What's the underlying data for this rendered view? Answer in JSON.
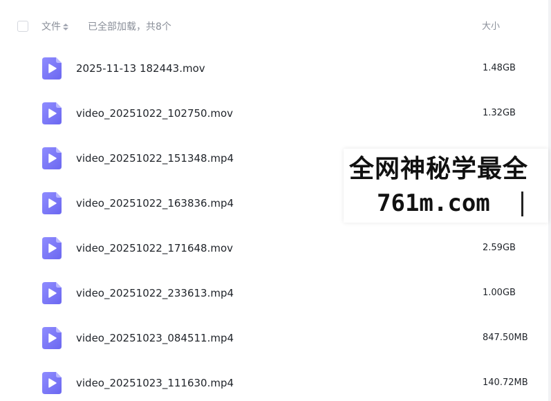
{
  "header": {
    "name_column_label": "文件",
    "load_status": "已全部加载，共8个",
    "size_column_label": "大小"
  },
  "files": [
    {
      "name": "2025-11-13 182443.mov",
      "size": "1.48GB",
      "icon": "video-file-icon"
    },
    {
      "name": "video_20251022_102750.mov",
      "size": "1.32GB",
      "icon": "video-file-icon"
    },
    {
      "name": "video_20251022_151348.mp4",
      "size": "",
      "icon": "video-file-icon"
    },
    {
      "name": "video_20251022_163836.mp4",
      "size": "",
      "icon": "video-file-icon"
    },
    {
      "name": "video_20251022_171648.mov",
      "size": "2.59GB",
      "icon": "video-file-icon"
    },
    {
      "name": "video_20251022_233613.mp4",
      "size": "1.00GB",
      "icon": "video-file-icon"
    },
    {
      "name": "video_20251023_084511.mp4",
      "size": "847.50MB",
      "icon": "video-file-icon"
    },
    {
      "name": "video_20251023_111630.mp4",
      "size": "140.72MB",
      "icon": "video-file-icon"
    }
  ],
  "watermark": {
    "line1": "全网神秘学最全",
    "line2": "761m.com"
  },
  "colors": {
    "icon_gradient_start": "#8f8cff",
    "icon_gradient_end": "#6b67f0",
    "header_text": "#8a8f99",
    "body_text": "#1f2329"
  }
}
